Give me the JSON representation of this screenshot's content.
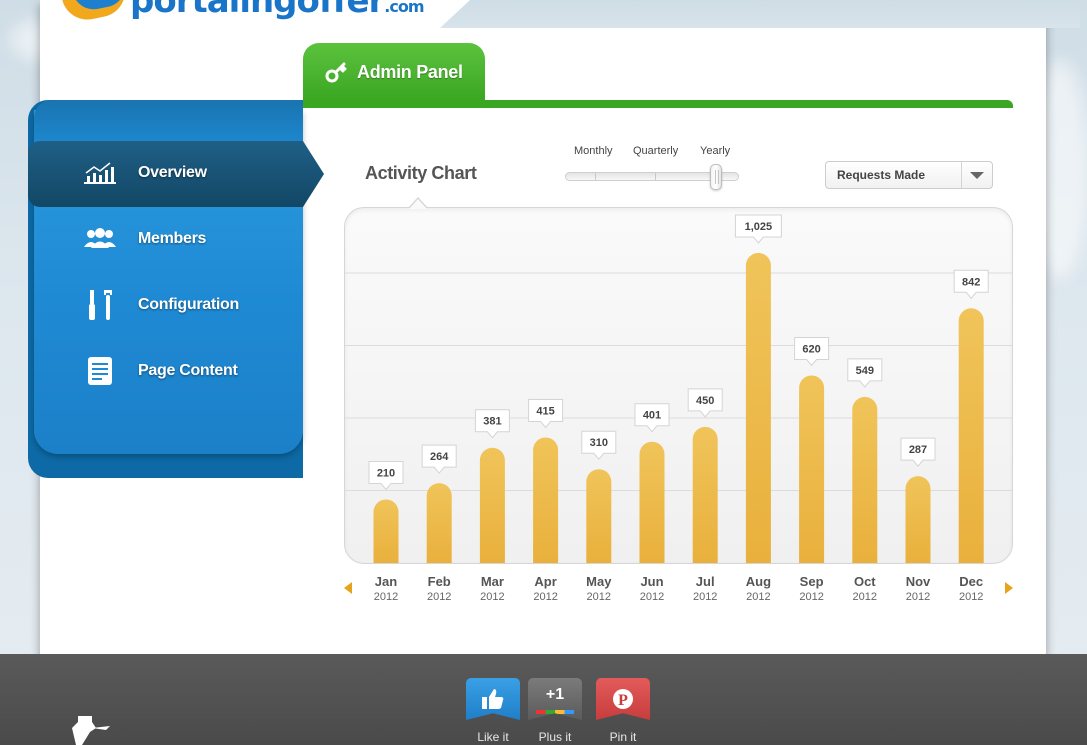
{
  "brand": {
    "logo_text": "portalingoffer",
    "logo_suffix": ".com"
  },
  "admin_tab": {
    "label": "Admin Panel"
  },
  "sidebar": {
    "items": [
      {
        "label": "Overview",
        "active": true,
        "icon": "chart-icon"
      },
      {
        "label": "Members",
        "active": false,
        "icon": "members-icon"
      },
      {
        "label": "Configuration",
        "active": false,
        "icon": "tools-icon"
      },
      {
        "label": "Page Content",
        "active": false,
        "icon": "document-icon"
      }
    ]
  },
  "chart_header": {
    "title": "Activity Chart",
    "periods": [
      "Monthly",
      "Quarterly",
      "Yearly"
    ],
    "selected_period": "Yearly",
    "metric_select": "Requests Made"
  },
  "chart_data": {
    "type": "bar",
    "categories": [
      "Jan",
      "Feb",
      "Mar",
      "Apr",
      "May",
      "Jun",
      "Jul",
      "Aug",
      "Sep",
      "Oct",
      "Nov",
      "Dec"
    ],
    "years": [
      "2012",
      "2012",
      "2012",
      "2012",
      "2012",
      "2012",
      "2012",
      "2012",
      "2012",
      "2012",
      "2012",
      "2012"
    ],
    "values": [
      210,
      264,
      381,
      415,
      310,
      401,
      450,
      1025,
      620,
      549,
      287,
      842
    ],
    "value_labels": [
      "210",
      "264",
      "381",
      "415",
      "310",
      "401",
      "450",
      "1,025",
      "620",
      "549",
      "287",
      "842"
    ],
    "ylim": [
      0,
      1200
    ],
    "grid": true,
    "bar_color": "#e9b03c"
  },
  "footer": {
    "social": [
      {
        "label": "Like it",
        "glyph": "",
        "color": "#2a8ed6",
        "icon": "thumbs-up-icon"
      },
      {
        "label": "Plus it",
        "glyph": "+1",
        "color": "#6a6a6a",
        "icon": "plus-one-icon"
      },
      {
        "label": "Pin it",
        "glyph": "P",
        "color": "#d84a4a",
        "icon": "pinterest-icon"
      }
    ]
  },
  "colors": {
    "accent_green": "#3aa622",
    "sidebar_blue": "#1f8ad4",
    "bar_gold": "#e9b03c"
  }
}
